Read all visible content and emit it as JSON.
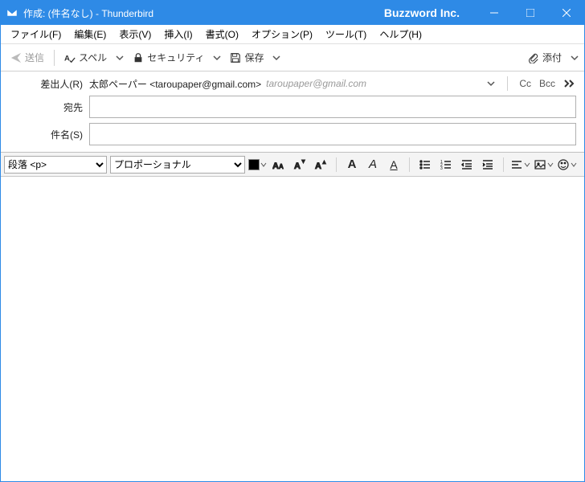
{
  "titlebar": {
    "title": "作成: (件名なし) - Thunderbird",
    "brand": "Buzzword Inc."
  },
  "menu": {
    "file": "ファイル(F)",
    "edit": "編集(E)",
    "view": "表示(V)",
    "insert": "挿入(I)",
    "format": "書式(O)",
    "options": "オプション(P)",
    "tools": "ツール(T)",
    "help": "ヘルプ(H)"
  },
  "toolbar": {
    "send": "送信",
    "spell": "スペル",
    "security": "セキュリティ",
    "save": "保存",
    "attach": "添付"
  },
  "fields": {
    "from_label": "差出人(R)",
    "from_value": "太郎ペーパー <taroupaper@gmail.com>",
    "from_hint": "taroupaper@gmail.com",
    "to_label": "宛先",
    "subject_label": "件名(S)",
    "cc": "Cc",
    "bcc": "Bcc"
  },
  "format": {
    "paragraph": "段落 <p>",
    "font": "プロポーショナル"
  }
}
